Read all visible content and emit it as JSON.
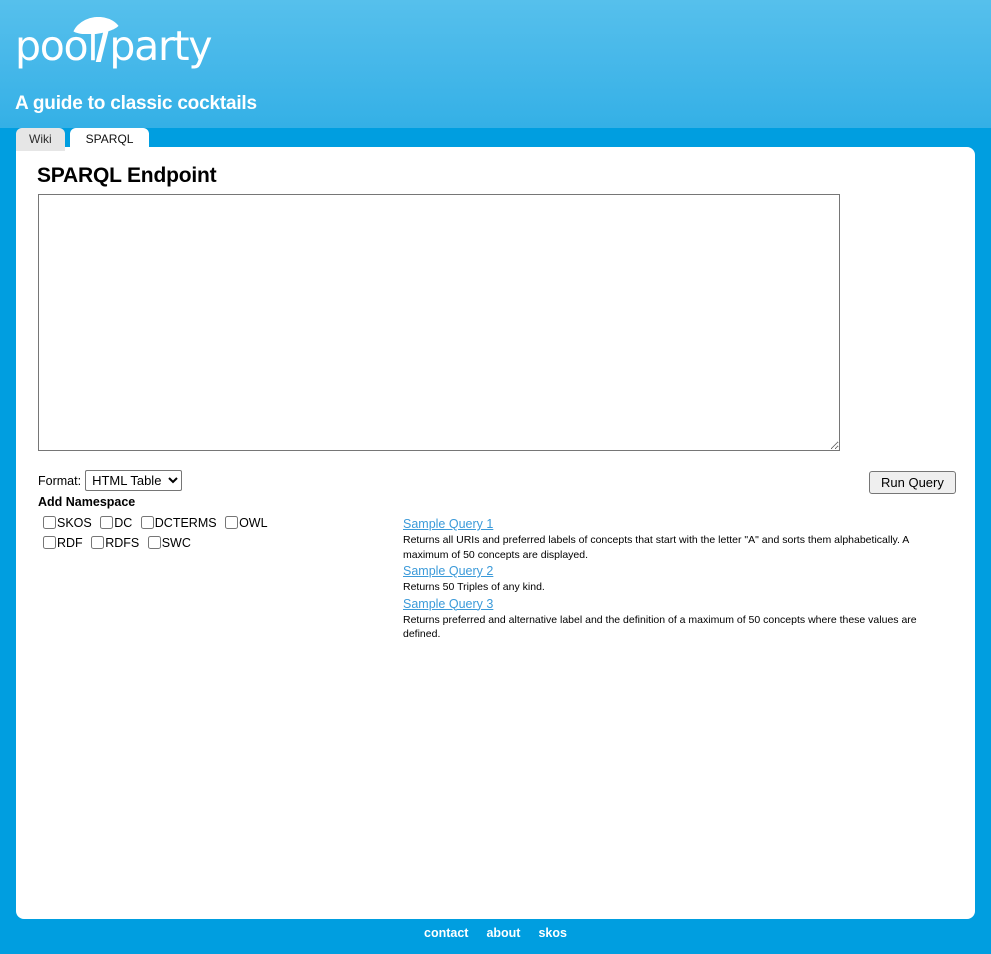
{
  "brand": {
    "logo_pool": "pool",
    "logo_party": "party",
    "logo_alt": "poolparty",
    "subtitle": "A guide to classic cocktails",
    "header_gradient_top": "#56c0ec",
    "header_gradient_bottom": "#34b0e6",
    "page_background": "#009ee0"
  },
  "tabs": [
    {
      "label": "Wiki",
      "active": false
    },
    {
      "label": "SPARQL",
      "active": true
    }
  ],
  "main": {
    "title": "SPARQL Endpoint",
    "query": {
      "value": "",
      "placeholder": ""
    },
    "format": {
      "label": "Format:",
      "selected": "HTML Table",
      "options": [
        "HTML Table"
      ]
    },
    "run_button": "Run Query",
    "namespace_heading": "Add Namespace",
    "namespaces": [
      {
        "label": "SKOS",
        "checked": false
      },
      {
        "label": "DC",
        "checked": false
      },
      {
        "label": "DCTERMS",
        "checked": false
      },
      {
        "label": "OWL",
        "checked": false
      },
      {
        "label": "RDF",
        "checked": false
      },
      {
        "label": "RDFS",
        "checked": false
      },
      {
        "label": "SWC",
        "checked": false
      }
    ],
    "samples": [
      {
        "link": "Sample Query 1",
        "description": "Returns all URIs and preferred labels of concepts that start with the letter \"A\" and sorts them alphabetically. A maximum of 50 concepts are displayed."
      },
      {
        "link": "Sample Query 2",
        "description": "Returns 50 Triples of any kind."
      },
      {
        "link": "Sample Query 3",
        "description": "Returns preferred and alternative label and the definition of a maximum of 50 concepts where these values are defined."
      }
    ],
    "link_color": "#3b9ad9"
  },
  "footer": {
    "links": [
      "contact",
      "about",
      "skos"
    ]
  }
}
